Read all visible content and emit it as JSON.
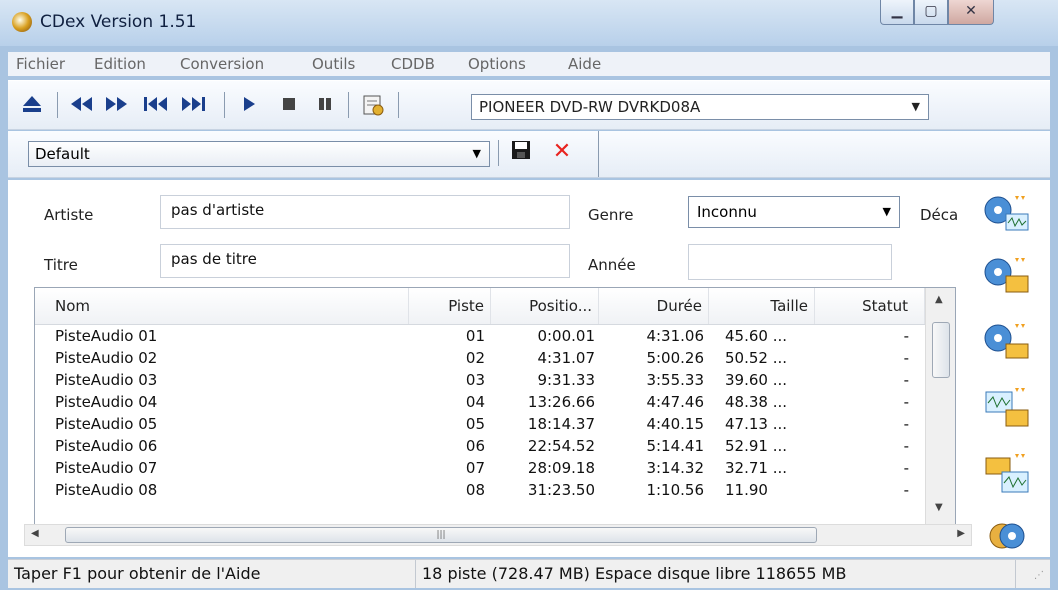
{
  "window": {
    "title": "CDex Version 1.51",
    "min_label": "▁",
    "max_label": "▢",
    "close_label": "✕"
  },
  "menu": [
    "Fichier",
    "Edition",
    "Conversion",
    "Outils",
    "CDDB",
    "Options",
    "Aide"
  ],
  "toolbar": {
    "drive": "PIONEER DVD-RW  DVRKD08A",
    "profile": "Default"
  },
  "fields": {
    "artist_label": "Artiste",
    "artist_value": "pas d'artiste",
    "title_label": "Titre",
    "title_value": "pas de titre",
    "genre_label": "Genre",
    "genre_value": "Inconnu",
    "year_label": "Année",
    "year_value": "",
    "offset_label": "Déca"
  },
  "table": {
    "columns": [
      "Nom",
      "Piste",
      "Positio...",
      "Durée",
      "Taille",
      "Statut"
    ],
    "rows": [
      [
        "PisteAudio 01",
        "01",
        "0:00.01",
        "4:31.06",
        "45.60 ...",
        "-"
      ],
      [
        "PisteAudio 02",
        "02",
        "4:31.07",
        "5:00.26",
        "50.52 ...",
        "-"
      ],
      [
        "PisteAudio 03",
        "03",
        "9:31.33",
        "3:55.33",
        "39.60 ...",
        "-"
      ],
      [
        "PisteAudio 04",
        "04",
        "13:26.66",
        "4:47.46",
        "48.38 ...",
        "-"
      ],
      [
        "PisteAudio 05",
        "05",
        "18:14.37",
        "4:40.15",
        "47.13 ...",
        "-"
      ],
      [
        "PisteAudio 06",
        "06",
        "22:54.52",
        "5:14.41",
        "52.91 ...",
        "-"
      ],
      [
        "PisteAudio 07",
        "07",
        "28:09.18",
        "3:14.32",
        "32.71 ...",
        "-"
      ],
      [
        "PisteAudio 08",
        "08",
        "31:23.50",
        "1:10.56",
        "11.90",
        "-"
      ]
    ]
  },
  "status": {
    "help": "Taper F1 pour obtenir de l'Aide",
    "info": "18 piste (728.47 MB) Espace disque libre 118655 MB"
  }
}
